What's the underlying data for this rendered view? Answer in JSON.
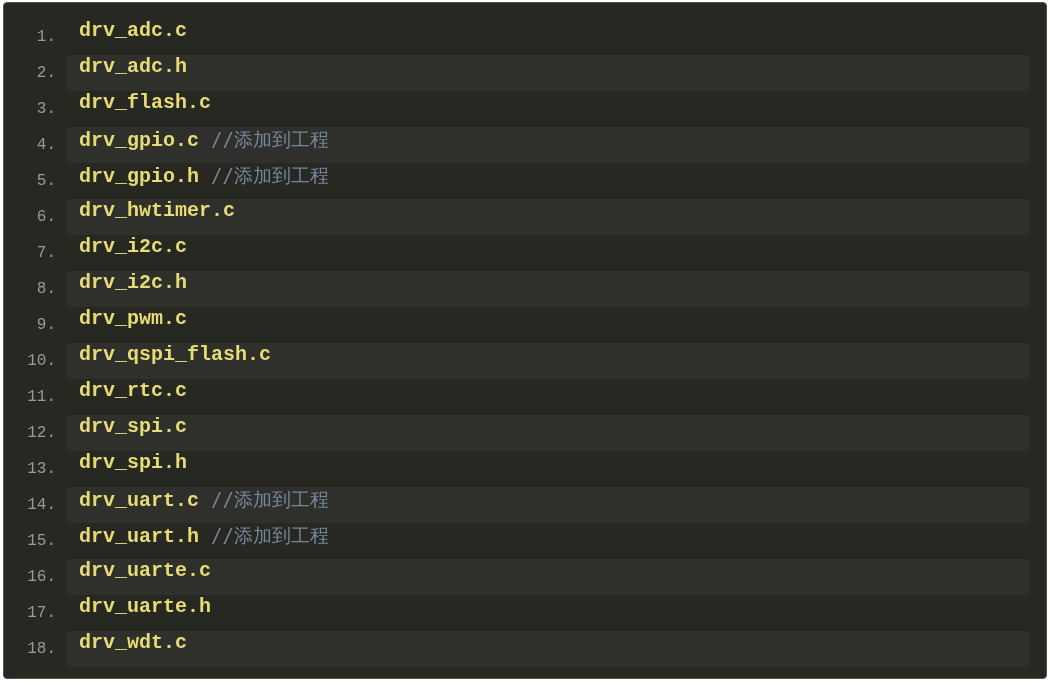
{
  "code_block": {
    "lines": [
      {
        "number": "1.",
        "tokens": [
          {
            "kind": "file",
            "text": "drv_adc.c"
          }
        ]
      },
      {
        "number": "2.",
        "tokens": [
          {
            "kind": "file",
            "text": "drv_adc.h"
          }
        ]
      },
      {
        "number": "3.",
        "tokens": [
          {
            "kind": "file",
            "text": "drv_flash.c"
          }
        ]
      },
      {
        "number": "4.",
        "tokens": [
          {
            "kind": "file",
            "text": "drv_gpio.c"
          },
          {
            "kind": "comment",
            "text": "//添加到工程"
          }
        ]
      },
      {
        "number": "5.",
        "tokens": [
          {
            "kind": "file",
            "text": "drv_gpio.h"
          },
          {
            "kind": "comment",
            "text": "//添加到工程"
          }
        ]
      },
      {
        "number": "6.",
        "tokens": [
          {
            "kind": "file",
            "text": "drv_hwtimer.c"
          }
        ]
      },
      {
        "number": "7.",
        "tokens": [
          {
            "kind": "file",
            "text": "drv_i2c.c"
          }
        ]
      },
      {
        "number": "8.",
        "tokens": [
          {
            "kind": "file",
            "text": "drv_i2c.h"
          }
        ]
      },
      {
        "number": "9.",
        "tokens": [
          {
            "kind": "file",
            "text": "drv_pwm.c"
          }
        ]
      },
      {
        "number": "10.",
        "tokens": [
          {
            "kind": "file",
            "text": "drv_qspi_flash.c"
          }
        ]
      },
      {
        "number": "11.",
        "tokens": [
          {
            "kind": "file",
            "text": "drv_rtc.c"
          }
        ]
      },
      {
        "number": "12.",
        "tokens": [
          {
            "kind": "file",
            "text": "drv_spi.c"
          }
        ]
      },
      {
        "number": "13.",
        "tokens": [
          {
            "kind": "file",
            "text": "drv_spi.h"
          }
        ]
      },
      {
        "number": "14.",
        "tokens": [
          {
            "kind": "file",
            "text": "drv_uart.c"
          },
          {
            "kind": "comment",
            "text": "//添加到工程"
          }
        ]
      },
      {
        "number": "15.",
        "tokens": [
          {
            "kind": "file",
            "text": "drv_uart.h"
          },
          {
            "kind": "comment",
            "text": "//添加到工程"
          }
        ]
      },
      {
        "number": "16.",
        "tokens": [
          {
            "kind": "file",
            "text": "drv_uarte.c"
          }
        ]
      },
      {
        "number": "17.",
        "tokens": [
          {
            "kind": "file",
            "text": "drv_uarte.h"
          }
        ]
      },
      {
        "number": "18.",
        "tokens": [
          {
            "kind": "file",
            "text": "drv_wdt.c"
          }
        ]
      }
    ]
  }
}
